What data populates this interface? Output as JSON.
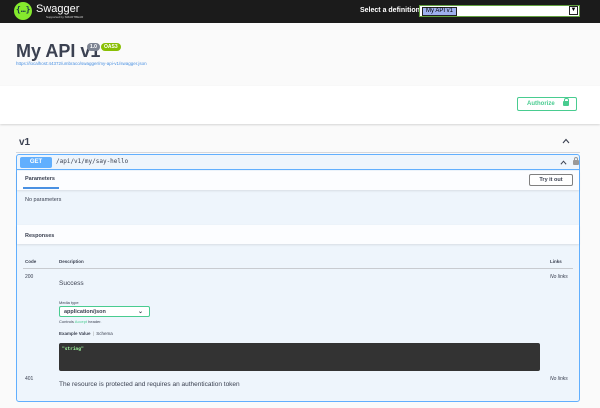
{
  "topbar": {
    "brand": "Swagger",
    "brand_sub": "Supported by SMARTBEAR",
    "definition_label": "Select a definition",
    "definition_value": "My API v1"
  },
  "info": {
    "title": "My API v1",
    "version_badge": "1.0",
    "oas_badge": "OAS3",
    "spec_url": "https://localhost:44372/umbraco/swagger/my-api-v1/swagger.json"
  },
  "auth": {
    "authorize_label": "Authorize"
  },
  "tag": {
    "name": "v1"
  },
  "operation": {
    "method": "GET",
    "path": "/api/v1/my/say-hello",
    "parameters_tab": "Parameters",
    "try_label": "Try it out",
    "no_params": "No parameters",
    "responses_title": "Responses",
    "headers": {
      "code": "Code",
      "description": "Description",
      "links": "Links"
    },
    "responses": [
      {
        "code": "200",
        "description": "Success",
        "links": "No links",
        "media_type_label": "Media type",
        "media_type": "application/json",
        "controls_prefix": "Controls ",
        "controls_accept": "Accept",
        "controls_suffix": " header.",
        "example_tab": "Example Value",
        "schema_tab": "Schema",
        "example_body": "\"string\""
      },
      {
        "code": "401",
        "description": "The resource is protected and requires an authentication token",
        "links": "No links"
      }
    ]
  },
  "colors": {
    "get": "#61affe",
    "authorize": "#49cc90",
    "topbar": "#1b1b1b"
  }
}
